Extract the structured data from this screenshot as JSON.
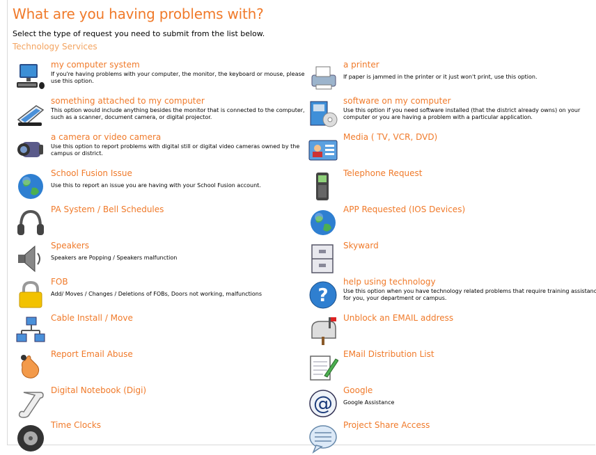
{
  "header": {
    "title": "What are you having problems with?",
    "subtitle": "Select the type of request you need to submit from the list below.",
    "section": "Technology Services"
  },
  "left_items": [
    {
      "label": "my computer system",
      "desc": "If you're having problems with your computer, the monitor, the keyboard or mouse, please use this option.",
      "icon": "computer-icon"
    },
    {
      "label": "something attached to my computer",
      "desc": "This option would include anything besides the monitor that is connected to the computer, such as a scanner, document camera, or digital projector.",
      "icon": "scanner-icon"
    },
    {
      "label": "a camera or video camera",
      "desc": "Use this option to report problems with digital still or digital video cameras owned by the campus or district.",
      "icon": "video-camera-icon"
    },
    {
      "label": "School Fusion Issue",
      "desc": "Use this to report an issue you are having with your School Fusion account.",
      "icon": "globe-icon"
    },
    {
      "label": "PA System / Bell Schedules",
      "desc": "",
      "icon": "headphones-icon"
    },
    {
      "label": "Speakers",
      "desc": "Speakers are Popping / Speakers malfunction",
      "icon": "speaker-icon"
    },
    {
      "label": "FOB",
      "desc": "Add/ Moves / Changes / Deletions of FOBs, Doors not working, malfunctions",
      "icon": "padlock-icon"
    },
    {
      "label": "Cable Install / Move",
      "desc": "",
      "icon": "network-icon"
    },
    {
      "label": "Report Email Abuse",
      "desc": "",
      "icon": "hand-icon"
    },
    {
      "label": "Digital Notebook (Digi)",
      "desc": "",
      "icon": "scroll-icon"
    },
    {
      "label": "Time Clocks",
      "desc": "",
      "icon": "tire-icon"
    }
  ],
  "right_items": [
    {
      "label": "a printer",
      "desc": "If paper is jammed in the printer or it just won't print, use this option.",
      "icon": "printer-icon"
    },
    {
      "label": "software on my computer",
      "desc": "Use this option if you need software installed (that the district already owns) on your computer or you are having a problem with a particular application.",
      "icon": "software-icon"
    },
    {
      "label": "Media ( TV, VCR, DVD)",
      "desc": "",
      "icon": "media-card-icon"
    },
    {
      "label": "Telephone Request",
      "desc": "",
      "icon": "phone-icon"
    },
    {
      "label": "APP Requested (IOS Devices)",
      "desc": "",
      "icon": "globe-icon"
    },
    {
      "label": "Skyward",
      "desc": "",
      "icon": "cabinet-icon"
    },
    {
      "label": "help using technology",
      "desc": "Use this option when you have technology related problems that require training assistance for you, your department or campus.",
      "icon": "help-icon"
    },
    {
      "label": "Unblock an EMAIL address",
      "desc": "",
      "icon": "mailbox-icon"
    },
    {
      "label": "EMail Distribution List",
      "desc": "",
      "icon": "notepad-icon"
    },
    {
      "label": "Google",
      "desc": "Google Assistance",
      "icon": "at-sign-icon"
    },
    {
      "label": "Project Share Access",
      "desc": "",
      "icon": "chat-bubble-icon"
    }
  ]
}
